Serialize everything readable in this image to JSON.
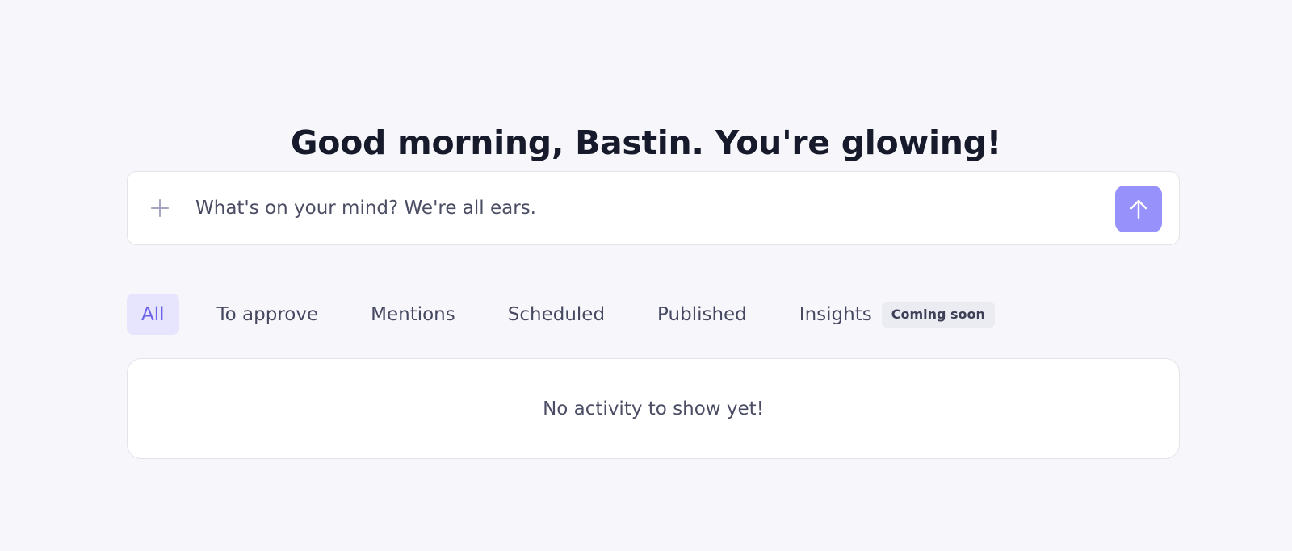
{
  "greeting": "Good morning, Bastin. You're glowing!",
  "composer": {
    "placeholder": "What's on your mind? We're all ears.",
    "add_icon": "plus-icon",
    "send_icon": "arrow-up-icon"
  },
  "tabs": [
    {
      "label": "All",
      "active": true
    },
    {
      "label": "To approve",
      "active": false
    },
    {
      "label": "Mentions",
      "active": false
    },
    {
      "label": "Scheduled",
      "active": false
    },
    {
      "label": "Published",
      "active": false
    },
    {
      "label": "Insights",
      "active": false,
      "badge": "Coming soon"
    }
  ],
  "activity": {
    "empty_message": "No activity to show yet!"
  },
  "colors": {
    "background": "#f7f7fb",
    "accent": "#9791fb",
    "active_tab_bg": "#e6e5fd",
    "active_tab_text": "#6a62e8",
    "title": "#161a2b"
  }
}
